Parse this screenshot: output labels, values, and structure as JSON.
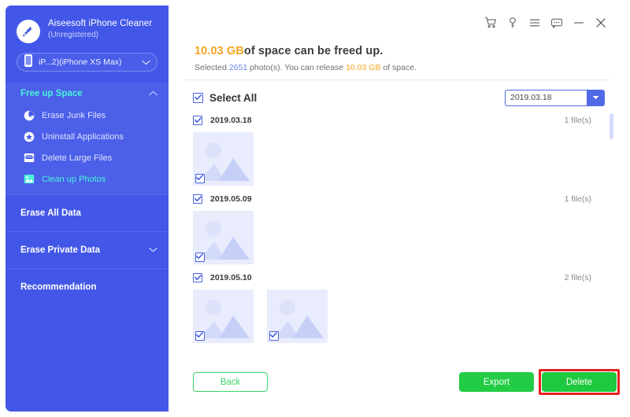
{
  "app": {
    "brand_name": "Aiseesoft iPhone Cleaner",
    "brand_status": "(Unregistered)",
    "logo_icon": "broom-icon"
  },
  "device": {
    "icon": "phone-icon",
    "label": "iP...2)(iPhone XS Max)",
    "chevron": "chevron-down-icon"
  },
  "sidebar": {
    "groups": [
      {
        "label": "Free up Space",
        "chevron": "chevron-up-icon",
        "expanded": true,
        "items": [
          {
            "label": "Erase Junk Files",
            "icon": "clock-icon"
          },
          {
            "label": "Uninstall Applications",
            "icon": "app-rocket-icon"
          },
          {
            "label": "Delete Large Files",
            "icon": "file-list-icon"
          },
          {
            "label": "Clean up Photos",
            "icon": "photo-icon",
            "active": true
          }
        ]
      },
      {
        "label": "Erase All Data",
        "chevron": ""
      },
      {
        "label": "Erase Private Data",
        "chevron": "chevron-down-icon"
      },
      {
        "label": "Recommendation",
        "chevron": ""
      }
    ]
  },
  "titlebar": {
    "icons": [
      {
        "name": "cart-icon"
      },
      {
        "name": "key-icon"
      },
      {
        "name": "menu-icon"
      },
      {
        "name": "feedback-icon"
      },
      {
        "name": "minimize-icon"
      },
      {
        "name": "close-icon"
      }
    ]
  },
  "header": {
    "amount": "10.03 GB",
    "headline_rest": "of space can be freed up.",
    "sub_prefix": "Selected ",
    "sub_count": "2651",
    "sub_mid": " photo(s). You can release ",
    "sub_amount": "10.03 GB",
    "sub_suffix": " of space."
  },
  "toolbar": {
    "select_all_label": "Select All",
    "select_all_checked": true,
    "filter_value": "2019.03.18",
    "filter_arrow": "caret-down-icon"
  },
  "list": {
    "groups": [
      {
        "date": "2019.03.18",
        "count": "1 file(s)",
        "checked": true,
        "thumbs": [
          {
            "checked": true,
            "icon": "image-placeholder-icon"
          }
        ]
      },
      {
        "date": "2019.05.09",
        "count": "1 file(s)",
        "checked": true,
        "thumbs": [
          {
            "checked": true,
            "icon": "image-placeholder-icon"
          }
        ]
      },
      {
        "date": "2019.05.10",
        "count": "2 file(s)",
        "checked": true,
        "thumbs": [
          {
            "checked": true,
            "icon": "image-placeholder-icon"
          },
          {
            "checked": true,
            "icon": "image-placeholder-icon"
          }
        ]
      }
    ]
  },
  "footer": {
    "back_label": "Back",
    "export_label": "Export",
    "delete_label": "Delete",
    "delete_highlight_color": "#e81f1f"
  },
  "colors": {
    "sidebar_bg": "#4257e8",
    "sidebar_group_bg": "#4b5fe9",
    "accent_cyan": "#4af3d7",
    "accent_orange": "#f5a623",
    "accent_blue": "#4f6ae4",
    "green_primary": "#22cc44"
  }
}
